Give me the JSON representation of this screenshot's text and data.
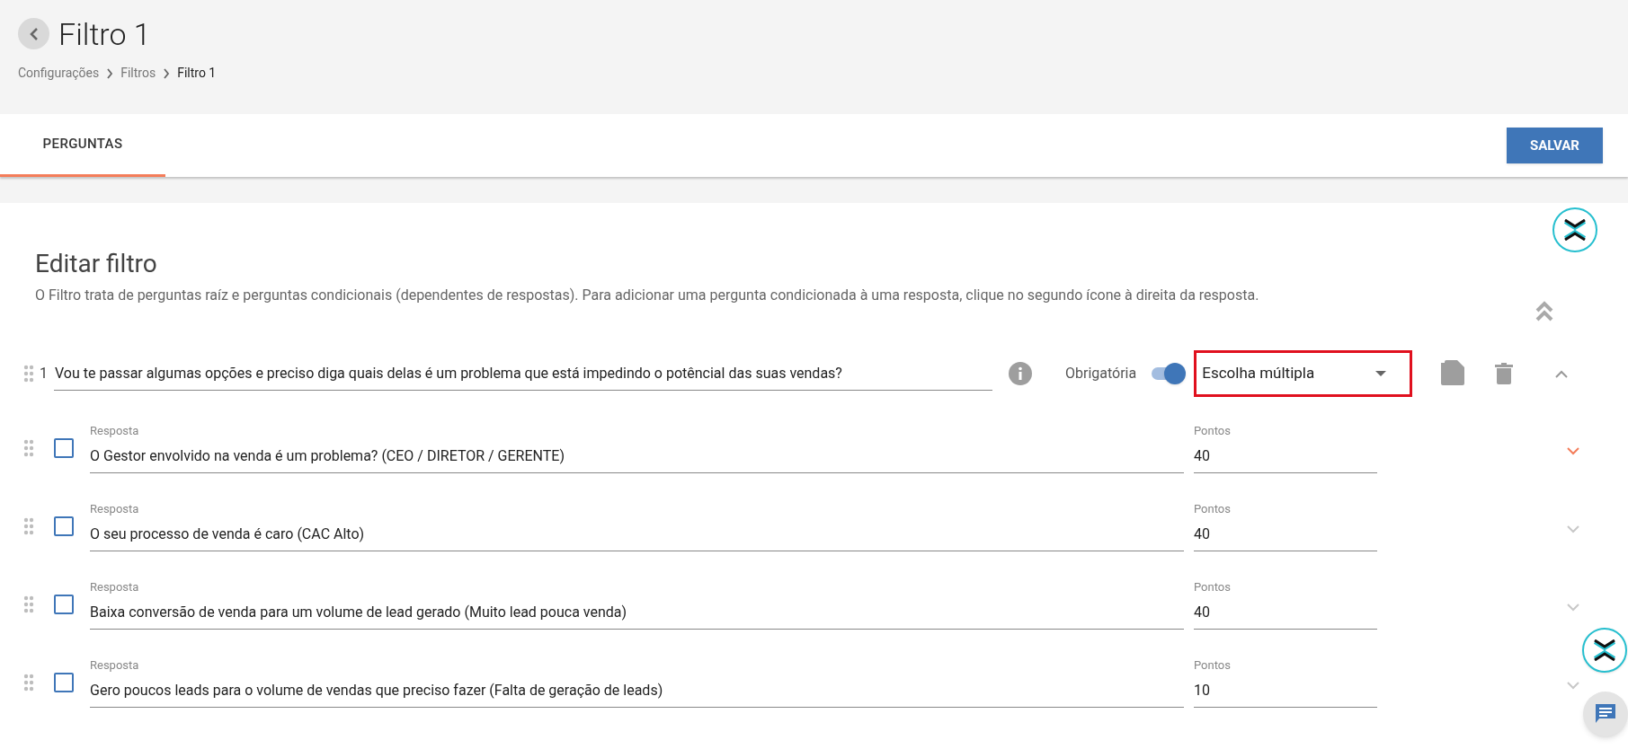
{
  "header": {
    "title": "Filtro 1",
    "breadcrumb": [
      {
        "label": "Configurações",
        "current": false
      },
      {
        "label": "Filtros",
        "current": false
      },
      {
        "label": "Filtro 1",
        "current": true
      }
    ]
  },
  "tabs": [
    {
      "label": "PERGUNTAS",
      "selected": true
    }
  ],
  "save_button": "SALVAR",
  "editor": {
    "title": "Editar filtro",
    "description": "O Filtro trata de perguntas raíz e perguntas condicionais (dependentes de respostas). Para adicionar uma pergunta condicionada à uma resposta, clique no segundo ícone à direita da resposta."
  },
  "question": {
    "number": "1",
    "text": "Vou te passar algumas opções e preciso diga quais delas é um problema que está impedindo o potêncial das suas vendas?",
    "required_label": "Obrigatória",
    "required": true,
    "type": "Escolha múltipla",
    "type_highlighted": true,
    "expanded": true
  },
  "answers": [
    {
      "label": "Resposta",
      "text": "O Gestor envolvido na venda é um problema? (CEO / DIRETOR / GERENTE)",
      "checked": false,
      "points_label": "Pontos",
      "points": "40",
      "highlighted": true
    },
    {
      "label": "Resposta",
      "text": "O seu processo de venda é caro (CAC Alto)",
      "checked": false,
      "points_label": "Pontos",
      "points": "40",
      "highlighted": false
    },
    {
      "label": "Resposta",
      "text": "Baixa conversão de venda para um volume de lead gerado (Muito lead pouca venda)",
      "checked": false,
      "points_label": "Pontos",
      "points": "40",
      "highlighted": false
    },
    {
      "label": "Resposta",
      "text": "Gero poucos leads para o volume de vendas que preciso fazer (Falta de geração de leads)",
      "checked": false,
      "points_label": "Pontos",
      "points": "10",
      "highlighted": false
    }
  ]
}
